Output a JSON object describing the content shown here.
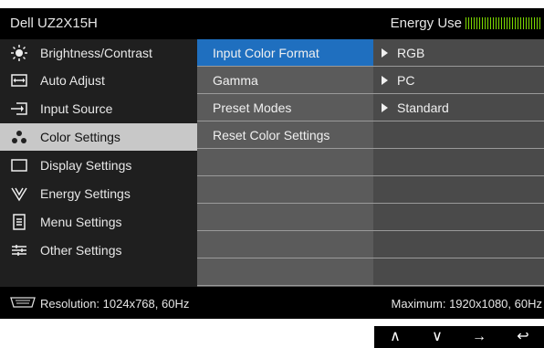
{
  "header": {
    "model": "Dell UZ2X15H",
    "energy_label": "Energy Use"
  },
  "sidebar": {
    "items": [
      {
        "label": "Brightness/Contrast",
        "icon": "brightness-icon",
        "active": false
      },
      {
        "label": "Auto Adjust",
        "icon": "auto-adjust-icon",
        "active": false
      },
      {
        "label": "Input Source",
        "icon": "input-source-icon",
        "active": false
      },
      {
        "label": "Color Settings",
        "icon": "color-settings-icon",
        "active": true
      },
      {
        "label": "Display Settings",
        "icon": "display-settings-icon",
        "active": false
      },
      {
        "label": "Energy Settings",
        "icon": "energy-settings-icon",
        "active": false
      },
      {
        "label": "Menu Settings",
        "icon": "menu-settings-icon",
        "active": false
      },
      {
        "label": "Other Settings",
        "icon": "other-settings-icon",
        "active": false
      }
    ]
  },
  "settings": [
    {
      "name": "Input Color Format",
      "value": "RGB",
      "selected": true
    },
    {
      "name": "Gamma",
      "value": "PC",
      "selected": false
    },
    {
      "name": "Preset Modes",
      "value": "Standard",
      "selected": false
    },
    {
      "name": "Reset Color Settings",
      "value": "",
      "selected": false
    }
  ],
  "footer": {
    "resolution": "Resolution: 1024x768, 60Hz",
    "maximum": "Maximum: 1920x1080, 60Hz"
  },
  "nav": {
    "up": "∧",
    "down": "∨",
    "right": "→",
    "back": "↩"
  },
  "colors": {
    "selected": "#1f6fbf",
    "active_sidebar": "#c8c8c8",
    "energy": "#7cd800"
  }
}
